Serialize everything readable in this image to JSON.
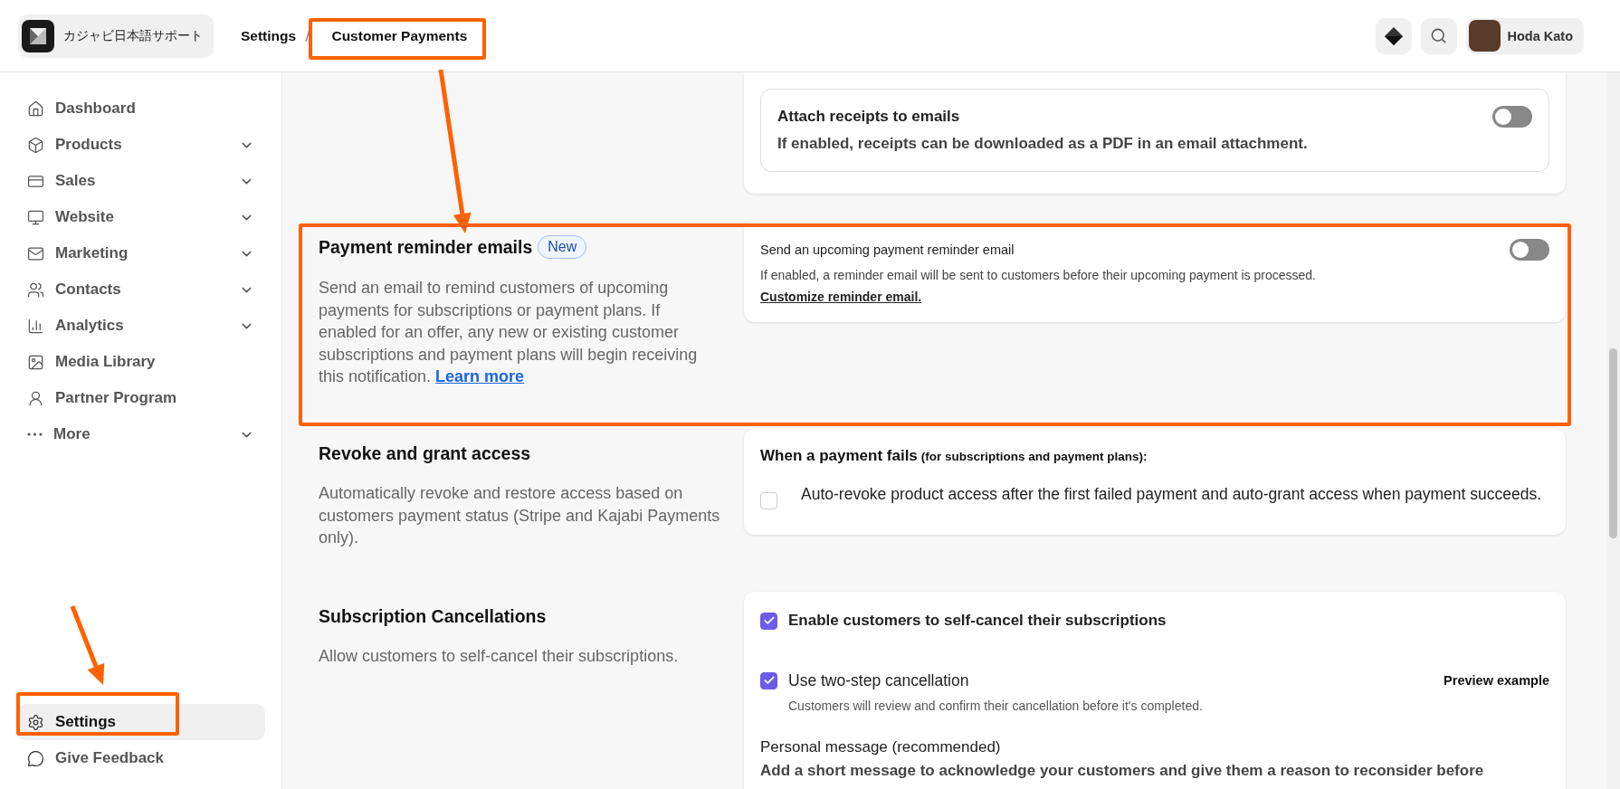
{
  "workspace": {
    "name": "カジャビ日本語サポート"
  },
  "breadcrumb": {
    "separator": "/",
    "items": [
      {
        "label": "Settings"
      },
      {
        "label": "Customer Payments"
      }
    ]
  },
  "user": {
    "name": "Hoda Kato"
  },
  "sidebar": {
    "items": [
      {
        "label": "Dashboard",
        "expandable": false,
        "selected": false
      },
      {
        "label": "Products",
        "expandable": true,
        "selected": false
      },
      {
        "label": "Sales",
        "expandable": true,
        "selected": false
      },
      {
        "label": "Website",
        "expandable": true,
        "selected": false
      },
      {
        "label": "Marketing",
        "expandable": true,
        "selected": false
      },
      {
        "label": "Contacts",
        "expandable": true,
        "selected": false
      },
      {
        "label": "Analytics",
        "expandable": true,
        "selected": false
      },
      {
        "label": "Media Library",
        "expandable": false,
        "selected": false
      },
      {
        "label": "Partner Program",
        "expandable": false,
        "selected": false
      },
      {
        "label": "More",
        "expandable": true,
        "selected": false
      }
    ],
    "footer": [
      {
        "label": "Settings",
        "selected": true
      },
      {
        "label": "Give Feedback",
        "selected": false
      }
    ]
  },
  "sections": [
    {
      "kind": "toggle",
      "card": {
        "title": "Attach receipts to emails",
        "text": "If enabled, receipts can be downloaded as a PDF in an email attachment.",
        "on": false
      }
    },
    {
      "kind": "toggle",
      "title": "Payment reminder emails",
      "badge": "New",
      "description": "Send an email to remind customers of upcoming payments for subscriptions or payment plans. If enabled for an offer, any new or existing customer subscriptions and payment plans will begin receiving this notification.",
      "link": "Learn more",
      "card": {
        "title": "Send an upcoming payment reminder email",
        "text": "If enabled, a reminder email will be sent to customers before their upcoming payment is processed.",
        "link": "Customize reminder email.",
        "on": false
      }
    },
    {
      "kind": "checkbox",
      "title": "Revoke and grant access",
      "description": "Automatically revoke and restore access based on customers payment status (Stripe and Kajabi Payments only).",
      "card": {
        "heading": "When a payment fails",
        "note": "(for subscriptions and payment plans):",
        "options": [
          {
            "label": "Auto-revoke product access after the first failed payment and auto-grant access when payment succeeds.",
            "checked": false
          }
        ]
      }
    },
    {
      "kind": "cancellation",
      "title": "Subscription Cancellations",
      "description": "Allow customers to self-cancel their subscriptions.",
      "card": {
        "options": [
          {
            "label": "Enable customers to self-cancel their subscriptions",
            "checked": true
          },
          {
            "label": "Use two-step cancellation",
            "checked": true,
            "hint": "Customers will review and confirm their cancellation before it's completed.",
            "action": "Preview example"
          }
        ],
        "message_label": "Personal message (recommended)",
        "message_hint": "Add a short message to acknowledge your customers and give them a reason to reconsider before"
      }
    }
  ]
}
